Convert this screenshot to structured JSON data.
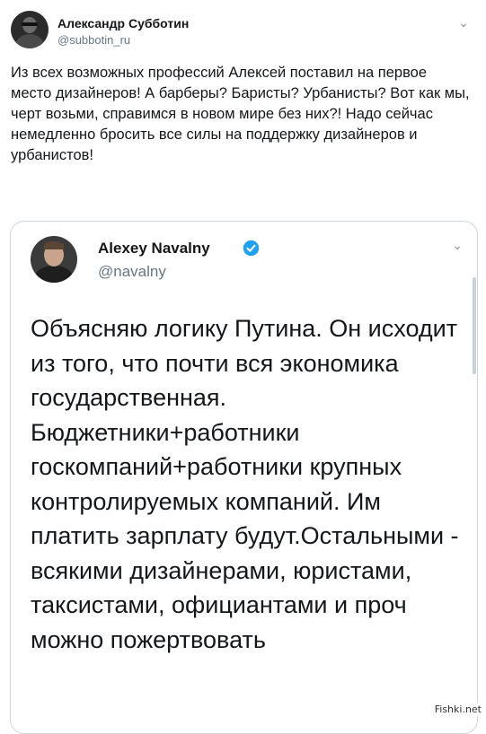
{
  "outer_tweet": {
    "author_name": "Александр Субботин",
    "handle": "@subbotin_ru",
    "text": "Из всех возможных профессий Алексей поставил на первое место дизайнеров! А барберы? Баристы? Урбанисты? Вот как мы, черт возьми, справимся в новом мире без них?! Надо сейчас немедленно бросить все силы на поддержку дизайнеров и урбанистов!"
  },
  "quoted_tweet": {
    "author_name": "Alexey Navalny",
    "handle": "@navalny",
    "verified": true,
    "text": "Объясняю логику Путина. Он исходит из того, что почти вся экономика государственная. Бюджетники+работники госкомпаний+работники крупных контролируемых компаний. Им платить зарплату будут.Остальными - всякими дизайнерами, юристами, таксистами, официантами и проч можно пожертвовать"
  },
  "watermark": "Fishki.net",
  "colors": {
    "accent": "#1da1f2",
    "text": "#14171a",
    "secondary": "#657786",
    "border": "#ccd6dd"
  },
  "icons": [
    "chevron-down-icon",
    "verified-badge-icon"
  ]
}
